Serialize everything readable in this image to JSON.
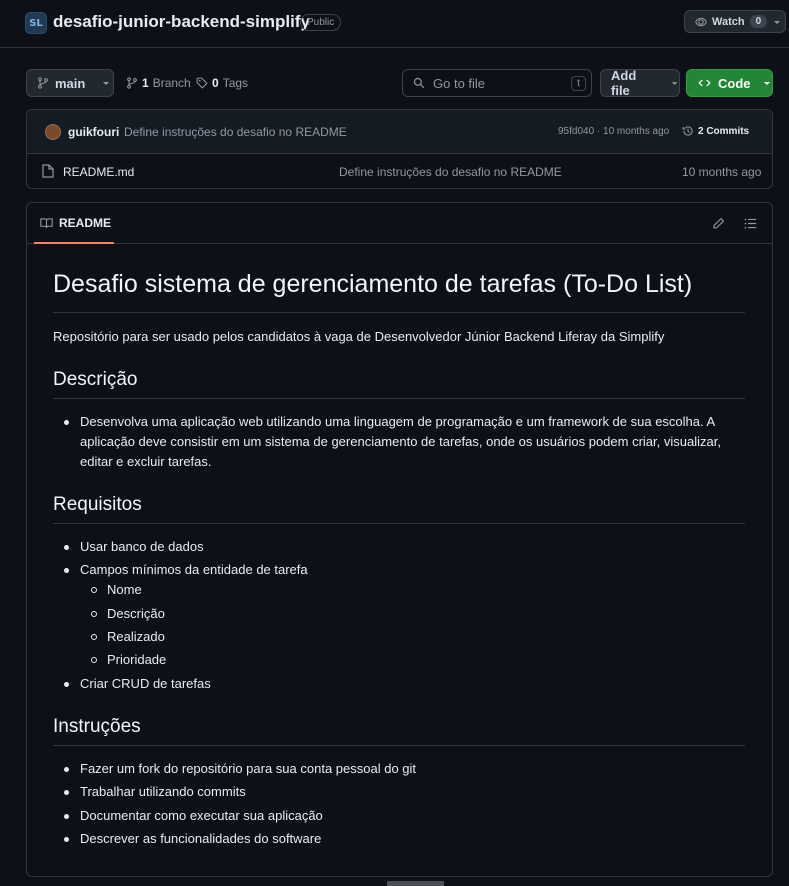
{
  "repo": {
    "avatar_text": "SL",
    "name": "desafio-junior-backend-simplify",
    "visibility": "Public",
    "watch_label": "Watch",
    "watch_count": "0"
  },
  "toolbar": {
    "branch": "main",
    "branch_count": "1",
    "branch_label": "Branch",
    "tag_count": "0",
    "tag_label": "Tags",
    "go_to_file_placeholder": "Go to file",
    "go_to_file_shortcut": "t",
    "add_file_label": "Add file",
    "code_label": "Code"
  },
  "latest_commit": {
    "user": "guikfouri",
    "message": "Define instruções do desafio no README",
    "meta": "95fd040 · 10 months ago",
    "commits_count_label": "2 Commits"
  },
  "files": [
    {
      "name": "README.md",
      "commit_message": "Define instruções do desafio no README",
      "date": "10 months ago"
    }
  ],
  "readme": {
    "tab_label": "README",
    "title": "Desafio sistema de gerenciamento de tarefas (To-Do List)",
    "intro": "Repositório para ser usado pelos candidatos à vaga de Desenvolvedor Júnior Backend Liferay da Simplify",
    "descricao_heading": "Descrição",
    "descricao_items": [
      "Desenvolva uma aplicação web utilizando uma linguagem de programação e um framework de sua escolha. A aplicação deve consistir em um sistema de gerenciamento de tarefas, onde os usuários podem criar, visualizar, editar e excluir tarefas."
    ],
    "requisitos_heading": "Requisitos",
    "requisitos_items": [
      "Usar banco de dados",
      "Campos mínimos da entidade de tarefa",
      "Criar CRUD de tarefas"
    ],
    "campos_subitems": [
      "Nome",
      "Descrição",
      "Realizado",
      "Prioridade"
    ],
    "instrucoes_heading": "Instruções",
    "instrucoes_items": [
      "Fazer um fork do repositório para sua conta pessoal do git",
      "Trabalhar utilizando commits",
      "Documentar como executar sua aplicação",
      "Descrever as funcionalidades do software"
    ]
  },
  "colors": {
    "background": "#0d1117",
    "border": "#30363d",
    "code_button": "#238636",
    "tab_underline": "#f78166"
  }
}
